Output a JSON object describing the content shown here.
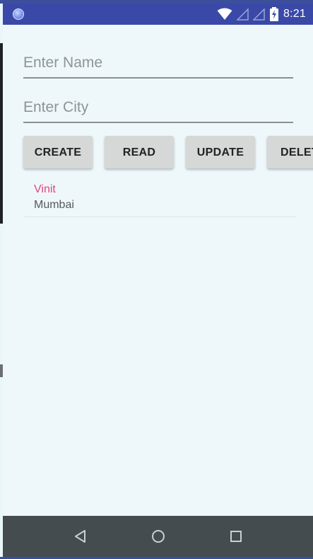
{
  "status_bar": {
    "time": "8:21",
    "icons": [
      "app-notification-icon",
      "wifi-icon",
      "signal-icon",
      "signal-icon",
      "battery-charging-icon"
    ]
  },
  "form": {
    "name_placeholder": "Enter Name",
    "name_value": "",
    "city_placeholder": "Enter City",
    "city_value": ""
  },
  "buttons": {
    "create": "CREATE",
    "read": "READ",
    "update": "UPDATE",
    "delete": "DELETE"
  },
  "records": [
    {
      "name": "Vinit",
      "city": "Mumbai"
    }
  ],
  "colors": {
    "status_bar": "#3a49a8",
    "background": "#eef8fb",
    "accent_name": "#e0487a",
    "nav_bar": "#454c50"
  },
  "nav_bar": {
    "icons": [
      "back-icon",
      "home-icon",
      "recent-apps-icon"
    ]
  }
}
